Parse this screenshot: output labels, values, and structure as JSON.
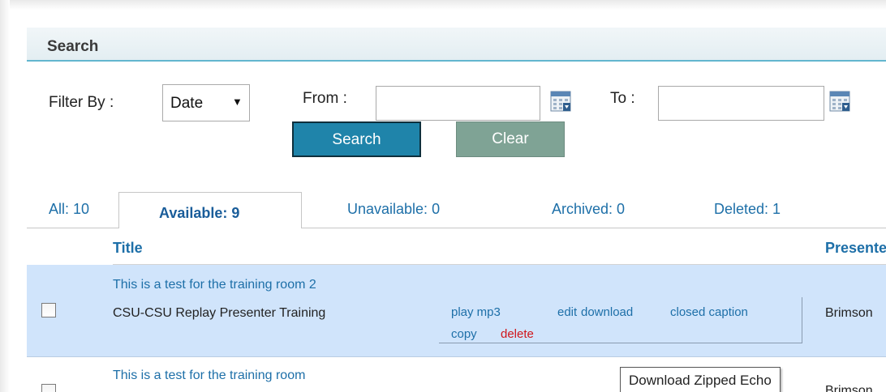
{
  "search": {
    "header_label": "Search",
    "filter_label": "Filter By :",
    "filter_value": "Date",
    "from_label": "From :",
    "from_value": "",
    "to_label": "To :",
    "to_value": "",
    "search_button": "Search",
    "clear_button": "Clear"
  },
  "tabs": {
    "all": "All: 10",
    "available": "Available: 9",
    "unavailable": "Unavailable: 0",
    "archived": "Archived: 0",
    "deleted": "Deleted: 1"
  },
  "columns": {
    "title": "Title",
    "presenter": "Presenter"
  },
  "rows": [
    {
      "title": "This is a test for the training room 2",
      "subtitle": "CSU-CSU Replay Presenter Training",
      "presenter": "Brimson",
      "actions": {
        "play": "play mp3",
        "edit": "edit",
        "download": "download",
        "closed_caption": "closed caption",
        "copy": "copy",
        "delete": "delete"
      }
    },
    {
      "title": "This is a test for the training room",
      "presenter": "Brimson"
    }
  ],
  "tooltip": "Download Zipped Echo",
  "colors": {
    "link": "#1d6fa8",
    "delete": "#d0161b",
    "search_button": "#1f84aa",
    "clear_button": "#7fa395",
    "selected_row": "#d0e4fb"
  },
  "icons": {
    "calendar": "calendar-icon",
    "dropdown": "chevron-down-icon"
  }
}
